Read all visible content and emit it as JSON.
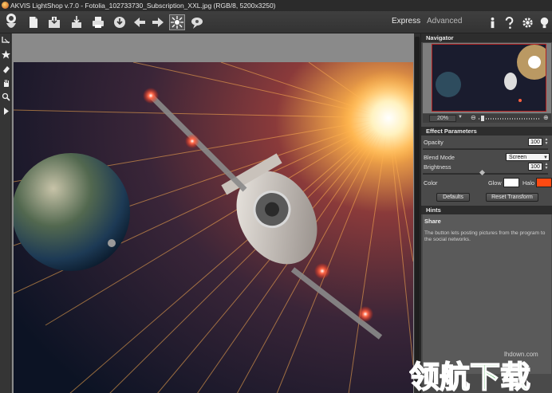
{
  "window": {
    "title": "AKVIS LightShop v.7.0 - Fotolia_102733730_Subscription_XXL.jpg (RGB/8, 5200x3250)"
  },
  "toolbar": {
    "buttons": [
      "open-icon",
      "save-icon",
      "batch-icon",
      "print-icon",
      "share-icon",
      "undo-icon",
      "redo-icon",
      "run-icon",
      "preset-icon"
    ],
    "mode_express": "Express",
    "mode_advanced": "Advanced",
    "right_icons": [
      "info-icon",
      "help-icon",
      "settings-icon",
      "tips-icon"
    ]
  },
  "left_tools": [
    "crop-tool-icon",
    "star-tool-icon",
    "eraser-tool-icon",
    "hand-tool-icon",
    "zoom-tool-icon",
    "play-tool-icon"
  ],
  "navigator": {
    "title": "Navigator",
    "zoom": "20%",
    "zoom_level": 0.05
  },
  "effect_parameters": {
    "title": "Effect Parameters",
    "opacity_label": "Opacity",
    "opacity_value": "100",
    "blend_label": "Blend Mode",
    "blend_value": "Screen",
    "brightness_label": "Brightness",
    "brightness_value": "100",
    "color_label": "Color",
    "glow_label": "Glow",
    "glow_color": "#ffffff",
    "halo_label": "Halo",
    "halo_color": "#ff4a12",
    "defaults_label": "Defaults",
    "reset_label": "Reset Transform"
  },
  "hints": {
    "title": "Hints",
    "heading": "Share",
    "text": "The button lets posting pictures from the program to the social networks."
  },
  "watermark": {
    "url": "lhdown.com",
    "text": "领航下载"
  },
  "colors": {
    "panel": "#4a4a4a",
    "header": "#2d2d2d",
    "accent": "#ff4a12"
  }
}
